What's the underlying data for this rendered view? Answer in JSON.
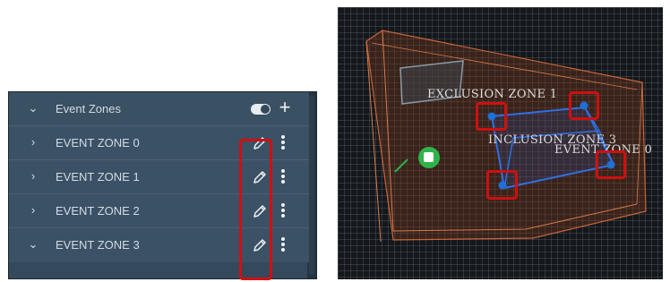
{
  "panel": {
    "header": {
      "label": "Event Zones",
      "toggle_on": true,
      "add_icon": "plus-icon"
    },
    "zones": [
      {
        "label": "EVENT ZONE 0",
        "expanded": false
      },
      {
        "label": "EVENT ZONE 1",
        "expanded": false
      },
      {
        "label": "EVENT ZONE 2",
        "expanded": false
      },
      {
        "label": "EVENT ZONE 3",
        "expanded": true
      }
    ]
  },
  "viewport": {
    "labels": {
      "exclusion": "EXCLUSION ZONE 1",
      "inclusion": "INCLUSION ZONE 3",
      "event": "EVENT ZONE 0"
    }
  },
  "colors": {
    "panel_bg": "#34495b",
    "highlight": "#d00f0f",
    "zone_outline": "#2f6fe0",
    "room_outline": "#c8643a",
    "handle": "#2fb34a"
  }
}
